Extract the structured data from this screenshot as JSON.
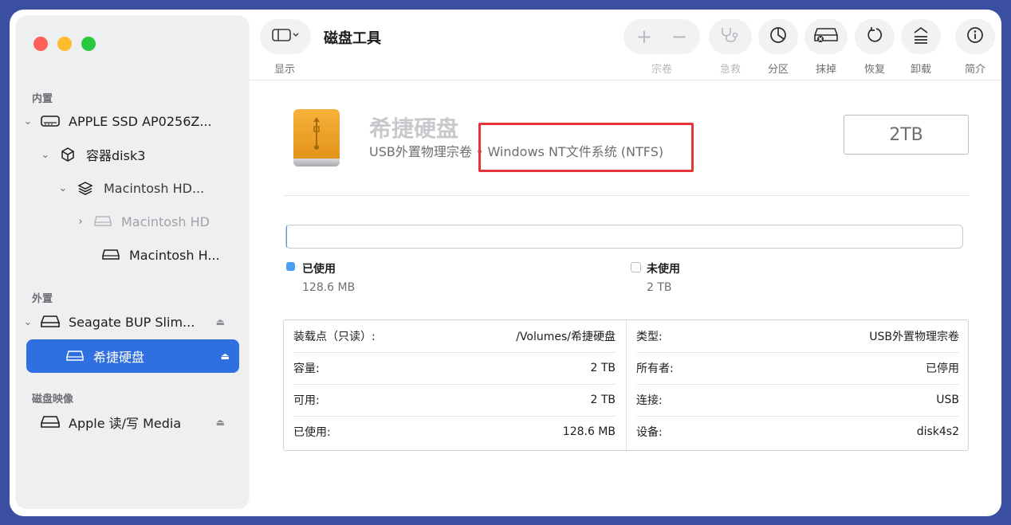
{
  "sidebar": {
    "sections": [
      "内置",
      "外置",
      "磁盘映像"
    ],
    "items": [
      {
        "label": "APPLE SSD AP0256Z...",
        "icon": "internal-disk-icon",
        "chevron": "⌄"
      },
      {
        "label": "容器disk3",
        "icon": "container-icon",
        "chevron": "⌄"
      },
      {
        "label": "Macintosh HD...",
        "icon": "layers-icon",
        "chevron": "⌄"
      },
      {
        "label": "Macintosh HD",
        "icon": "volume-icon",
        "chevron": "›"
      },
      {
        "label": "Macintosh H...",
        "icon": "volume-icon"
      },
      {
        "label": "Seagate BUP Slim...",
        "icon": "external-disk-icon",
        "chevron": "⌄",
        "eject": "⏏"
      },
      {
        "label": "希捷硬盘",
        "icon": "volume-icon",
        "eject": "⏏"
      },
      {
        "label": "Apple 读/写 Media",
        "icon": "image-disk-icon",
        "eject": "⏏"
      }
    ]
  },
  "toolbar": {
    "title": "磁盘工具",
    "view_label": "显示",
    "volume_label": "宗卷",
    "rescue_label": "急救",
    "partition_label": "分区",
    "erase_label": "抹掉",
    "restore_label": "恢复",
    "unmount_label": "卸载",
    "info_label": "简介"
  },
  "volume": {
    "name": "希捷硬盘",
    "subtitle": "USB外置物理宗卷 • Windows NT文件系统 (NTFS)",
    "size": "2TB"
  },
  "usage": {
    "used_label": "已使用",
    "used_value": "128.6 MB",
    "used_color": "#4a9ff5",
    "free_label": "未使用",
    "free_value": "2 TB",
    "used_fraction": 0.0001
  },
  "info": {
    "left": [
      {
        "key": "装载点（只读）:",
        "value": "/Volumes/希捷硬盘"
      },
      {
        "key": "容量:",
        "value": "2 TB"
      },
      {
        "key": "可用:",
        "value": "2 TB"
      },
      {
        "key": "已使用:",
        "value": "128.6 MB"
      }
    ],
    "right": [
      {
        "key": "类型:",
        "value": "USB外置物理宗卷"
      },
      {
        "key": "所有者:",
        "value": "已停用"
      },
      {
        "key": "连接:",
        "value": "USB"
      },
      {
        "key": "设备:",
        "value": "disk4s2"
      }
    ]
  },
  "colors": {
    "accent": "#2f6fe0",
    "highlight": "#e5343a"
  }
}
